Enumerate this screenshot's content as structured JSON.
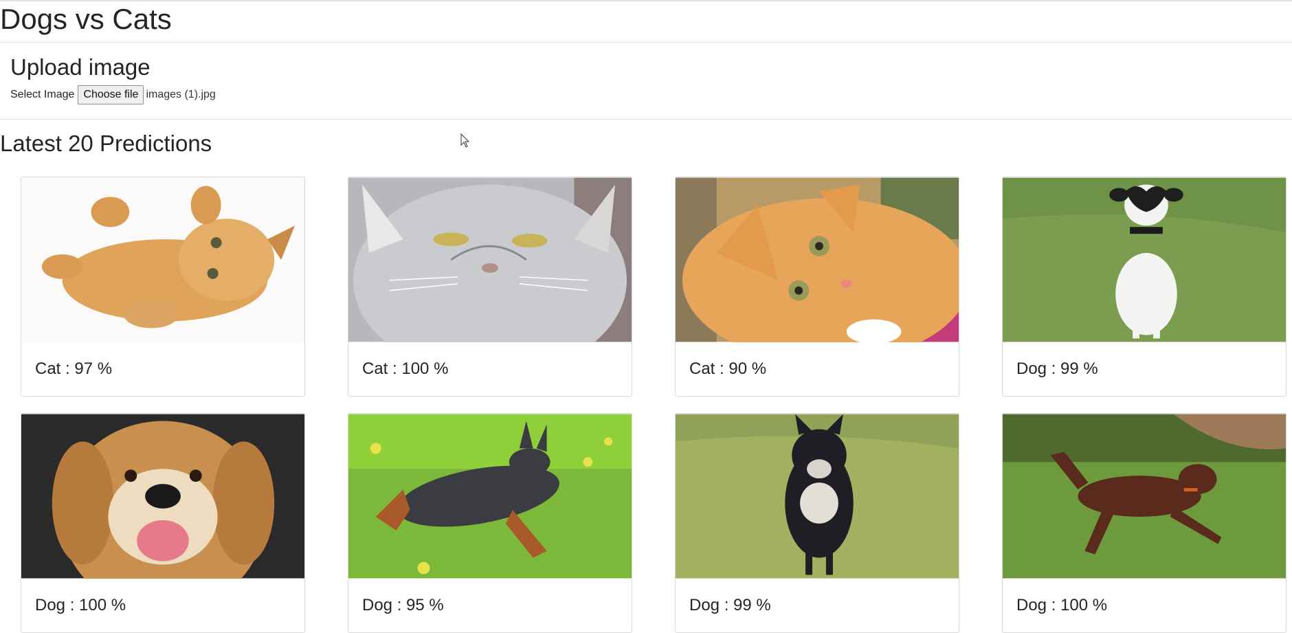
{
  "page": {
    "title": "Dogs vs Cats"
  },
  "upload": {
    "heading": "Upload image",
    "select_label": "Select Image",
    "choose_button": "Choose file",
    "file_name": "images (1).jpg"
  },
  "predictions": {
    "heading": "Latest 20 Predictions",
    "cards": [
      {
        "label": "Cat : 97 %",
        "animal": "cat-orange-kitten"
      },
      {
        "label": "Cat : 100 %",
        "animal": "cat-gray-persian"
      },
      {
        "label": "Cat : 90 %",
        "animal": "cat-orange-tabby"
      },
      {
        "label": "Dog : 99 %",
        "animal": "dog-black-white-on-grass"
      },
      {
        "label": "Dog : 100 %",
        "animal": "dog-golden-retriever"
      },
      {
        "label": "Dog : 95 %",
        "animal": "dog-miniature-pinscher"
      },
      {
        "label": "Dog : 99 %",
        "animal": "dog-black-husky"
      },
      {
        "label": "Dog : 100 %",
        "animal": "dog-brown-running"
      }
    ]
  }
}
